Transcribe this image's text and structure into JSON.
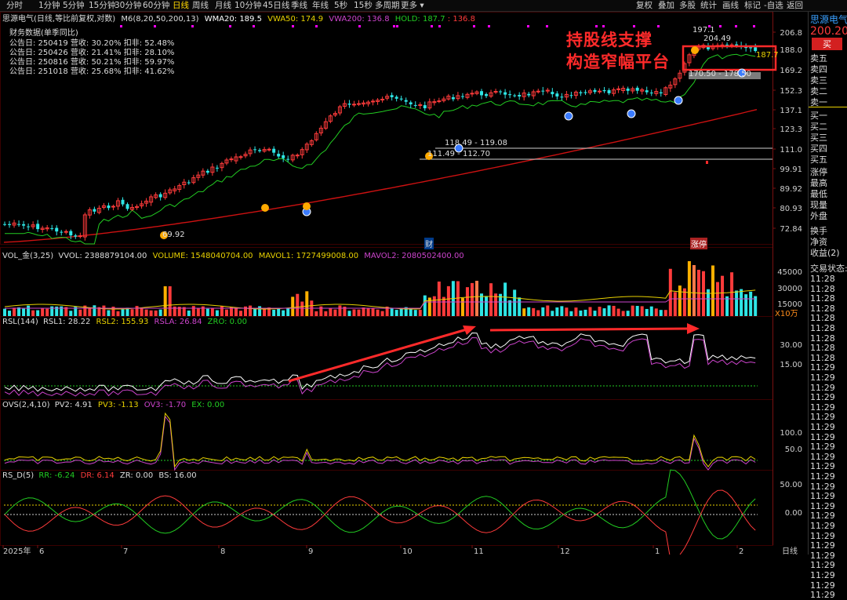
{
  "toolbar": {
    "left": [
      "分时",
      "1分钟",
      "5分钟",
      "15分钟",
      "30分钟",
      "60分钟",
      "日线",
      "周线",
      "月线",
      "10分钟",
      "45日线",
      "季线",
      "年线",
      "5秒",
      "15秒",
      "多周期",
      "更多"
    ],
    "active_index": 6,
    "right": [
      "复权",
      "叠加",
      "多股",
      "统计",
      "画线",
      "标记",
      "-自选",
      "返回"
    ]
  },
  "main": {
    "title": "思源电气(日线,等比前复权,对数)",
    "ma_label": "M6(8,20,50,200,13)",
    "wma": "WMA20: 189.5",
    "vwa50": "VWA50: 174.9",
    "vwa200": "VWA200: 136.8",
    "hold": "HOLD: 187.7",
    "hold2": ": 136.8",
    "finance_title": "财务数据(单季同比)",
    "finance": [
      "公告日: 250419  营收: 30.20%  扣非: 52.48%",
      "公告日: 250426  营收: 21.41%  扣非: 28.10%",
      "公告日: 250816  营收: 50.21%  扣非: 59.97%",
      "公告日: 251018  营收: 25.68%  扣非: 41.62%"
    ],
    "annotation_line1": "持股线支撑",
    "annotation_line2": "构造窄幅平台",
    "hline1": "118.49 - 119.08",
    "hline2": "111.49 - 112.70",
    "hline3": "170.50 - 178.50",
    "low_label": "69.92",
    "high_label": "204.49",
    "box_label1": "197.1",
    "box_label2": "187.7",
    "price_axis": [
      "206.8",
      "188.0",
      "169.2",
      "152.3",
      "137.1",
      "123.3",
      "111.0",
      "99.91",
      "89.92",
      "80.93",
      "72.84"
    ],
    "marker_cai": "财",
    "marker_zhangting": "涨",
    "marker_zhangting2": "停"
  },
  "vol": {
    "label": "VOL_金(3,25)",
    "vvol": "VVOL: 2388879104.00",
    "volume": "VOLUME: 1548040704.00",
    "mavol1": "MAVOL1: 1727499008.00",
    "mavol2": "MAVOL2: 2080502400.00",
    "axis": [
      "45000",
      "30000",
      "15000"
    ],
    "unit": "X10万"
  },
  "rsl": {
    "label": "RSL(144)",
    "rsl1": "RSL1: 28.22",
    "rsl2": "RSL2: 155.93",
    "rsla": "RSLA: 26.84",
    "zro": "ZRO: 0.00",
    "axis": [
      "30.00",
      "15.00"
    ]
  },
  "ovs": {
    "label": "OVS(2,4,10)",
    "pv2": "PV2: 4.91",
    "pv3": "PV3: -1.13",
    "ov3": "OV3: -1.70",
    "ex": "EX: 0.00",
    "axis": [
      "100.0",
      "50.0"
    ]
  },
  "rsd": {
    "label": "RS_D(5)",
    "rr": "RR: -6.24",
    "dr": "DR: 6.14",
    "zr": "ZR: 0.00",
    "bs": "BS: 16.00",
    "axis": [
      "50.00",
      "0.00"
    ]
  },
  "xaxis": [
    "2025年",
    "6",
    "7",
    "8",
    "9",
    "10",
    "11",
    "12",
    "1",
    "2"
  ],
  "xaxis_right": "日线",
  "right_panel": {
    "name": "思源电气",
    "price": "200.20",
    "buy_button": "买",
    "sell": [
      "卖五",
      "卖四",
      "卖三",
      "卖二",
      "卖一"
    ],
    "buy": [
      "买一",
      "买二",
      "买三",
      "买四",
      "买五"
    ],
    "stats": [
      "涨停",
      "最高",
      "最低",
      "现量",
      "外盘"
    ],
    "stats2": [
      "换手",
      "净资",
      "收益(2)"
    ],
    "trade_status": "交易状态:",
    "times": [
      "11:28",
      "11:28",
      "11:28",
      "11:28",
      "11:28",
      "11:28",
      "11:28",
      "11:28",
      "11:28",
      "11:29",
      "11:29",
      "11:29",
      "11:29",
      "11:29",
      "11:29",
      "11:29",
      "11:29",
      "11:29",
      "11:29",
      "11:29",
      "11:29",
      "11:29",
      "11:29",
      "11:29",
      "11:29",
      "11:29",
      "11:29",
      "11:29",
      "11:29",
      "11:29",
      "11:29",
      "11:29",
      "11:29"
    ]
  },
  "colors": {
    "up": "#ff3b3b",
    "down": "#2ee6e6",
    "ma_green": "#22cc22",
    "ma_red": "#cc1111",
    "purple": "#cc44cc",
    "yellow": "#e8d100",
    "annotation": "#ff2a2a"
  }
}
